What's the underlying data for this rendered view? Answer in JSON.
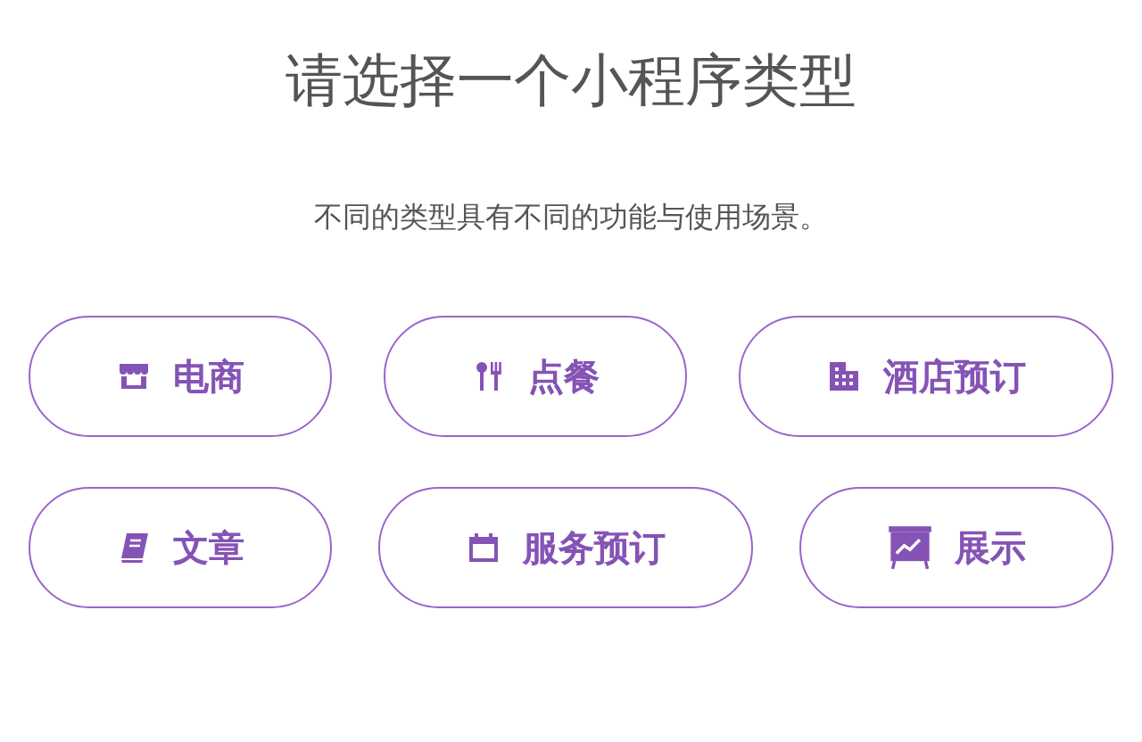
{
  "title": "请选择一个小程序类型",
  "subtitle": "不同的类型具有不同的功能与使用场景。",
  "rows": [
    [
      {
        "label": "电商"
      },
      {
        "label": "点餐"
      },
      {
        "label": "酒店预订"
      }
    ],
    [
      {
        "label": "文章"
      },
      {
        "label": "服务预订"
      },
      {
        "label": "展示"
      }
    ]
  ]
}
